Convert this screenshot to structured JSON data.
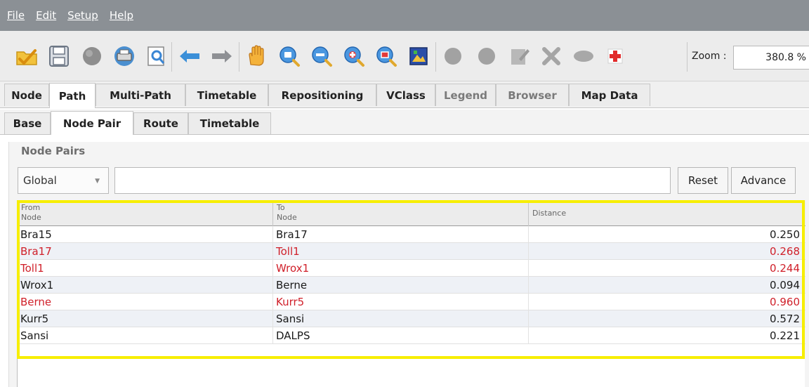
{
  "menu": [
    {
      "label": "File"
    },
    {
      "label": "Edit"
    },
    {
      "label": "Setup"
    },
    {
      "label": "Help"
    }
  ],
  "toolbar": {
    "icons": [
      "open-folder-icon",
      "save-icon",
      "globe-icon",
      "print-icon",
      "preview-icon",
      "undo-icon",
      "redo-icon",
      "pan-hand-icon",
      "zoom-fit-icon",
      "zoom-out-icon",
      "zoom-in-icon",
      "zoom-window-icon",
      "image-icon",
      "disabled-circle-icon",
      "disabled-circle-icon",
      "disabled-edit-icon",
      "delete-icon",
      "disabled-ellipse-icon",
      "add-icon"
    ],
    "zoom_label": "Zoom :",
    "zoom_value": "380.8 %"
  },
  "main_tabs": [
    {
      "label": "Node",
      "active": false,
      "disabled": false
    },
    {
      "label": "Path",
      "active": true,
      "disabled": false
    },
    {
      "label": "Multi-Path",
      "active": false,
      "disabled": false
    },
    {
      "label": "Timetable",
      "active": false,
      "disabled": false
    },
    {
      "label": "Repositioning",
      "active": false,
      "disabled": false
    },
    {
      "label": "VClass",
      "active": false,
      "disabled": false
    },
    {
      "label": "Legend",
      "active": false,
      "disabled": true
    },
    {
      "label": "Browser",
      "active": false,
      "disabled": true
    },
    {
      "label": "Map Data",
      "active": false,
      "disabled": false
    }
  ],
  "sub_tabs": [
    {
      "label": "Base",
      "active": false
    },
    {
      "label": "Node Pair",
      "active": true
    },
    {
      "label": "Route",
      "active": false
    },
    {
      "label": "Timetable",
      "active": false
    }
  ],
  "panel": {
    "title": "Node Pairs",
    "scope_value": "Global",
    "filter_value": "",
    "reset_label": "Reset",
    "advance_label": "Advance"
  },
  "table": {
    "columns": [
      {
        "line1": "From",
        "line2": "Node"
      },
      {
        "line1": "To",
        "line2": "Node"
      },
      {
        "line1": "Distance",
        "line2": ""
      }
    ],
    "rows": [
      {
        "from": "Bra15",
        "to": "Bra17",
        "distance": "0.250",
        "highlight": false
      },
      {
        "from": "Bra17",
        "to": "Toll1",
        "distance": "0.268",
        "highlight": true
      },
      {
        "from": "Toll1",
        "to": "Wrox1",
        "distance": "0.244",
        "highlight": true
      },
      {
        "from": "Wrox1",
        "to": "Berne",
        "distance": "0.094",
        "highlight": false
      },
      {
        "from": "Berne",
        "to": "Kurr5",
        "distance": "0.960",
        "highlight": true
      },
      {
        "from": "Kurr5",
        "to": "Sansi",
        "distance": "0.572",
        "highlight": false
      },
      {
        "from": "Sansi",
        "to": "DALPS",
        "distance": "0.221",
        "highlight": false
      }
    ]
  },
  "colors": {
    "highlight_text": "#d0202a",
    "selection_outline": "#f7ee00",
    "menubar_bg": "#8b9095"
  }
}
